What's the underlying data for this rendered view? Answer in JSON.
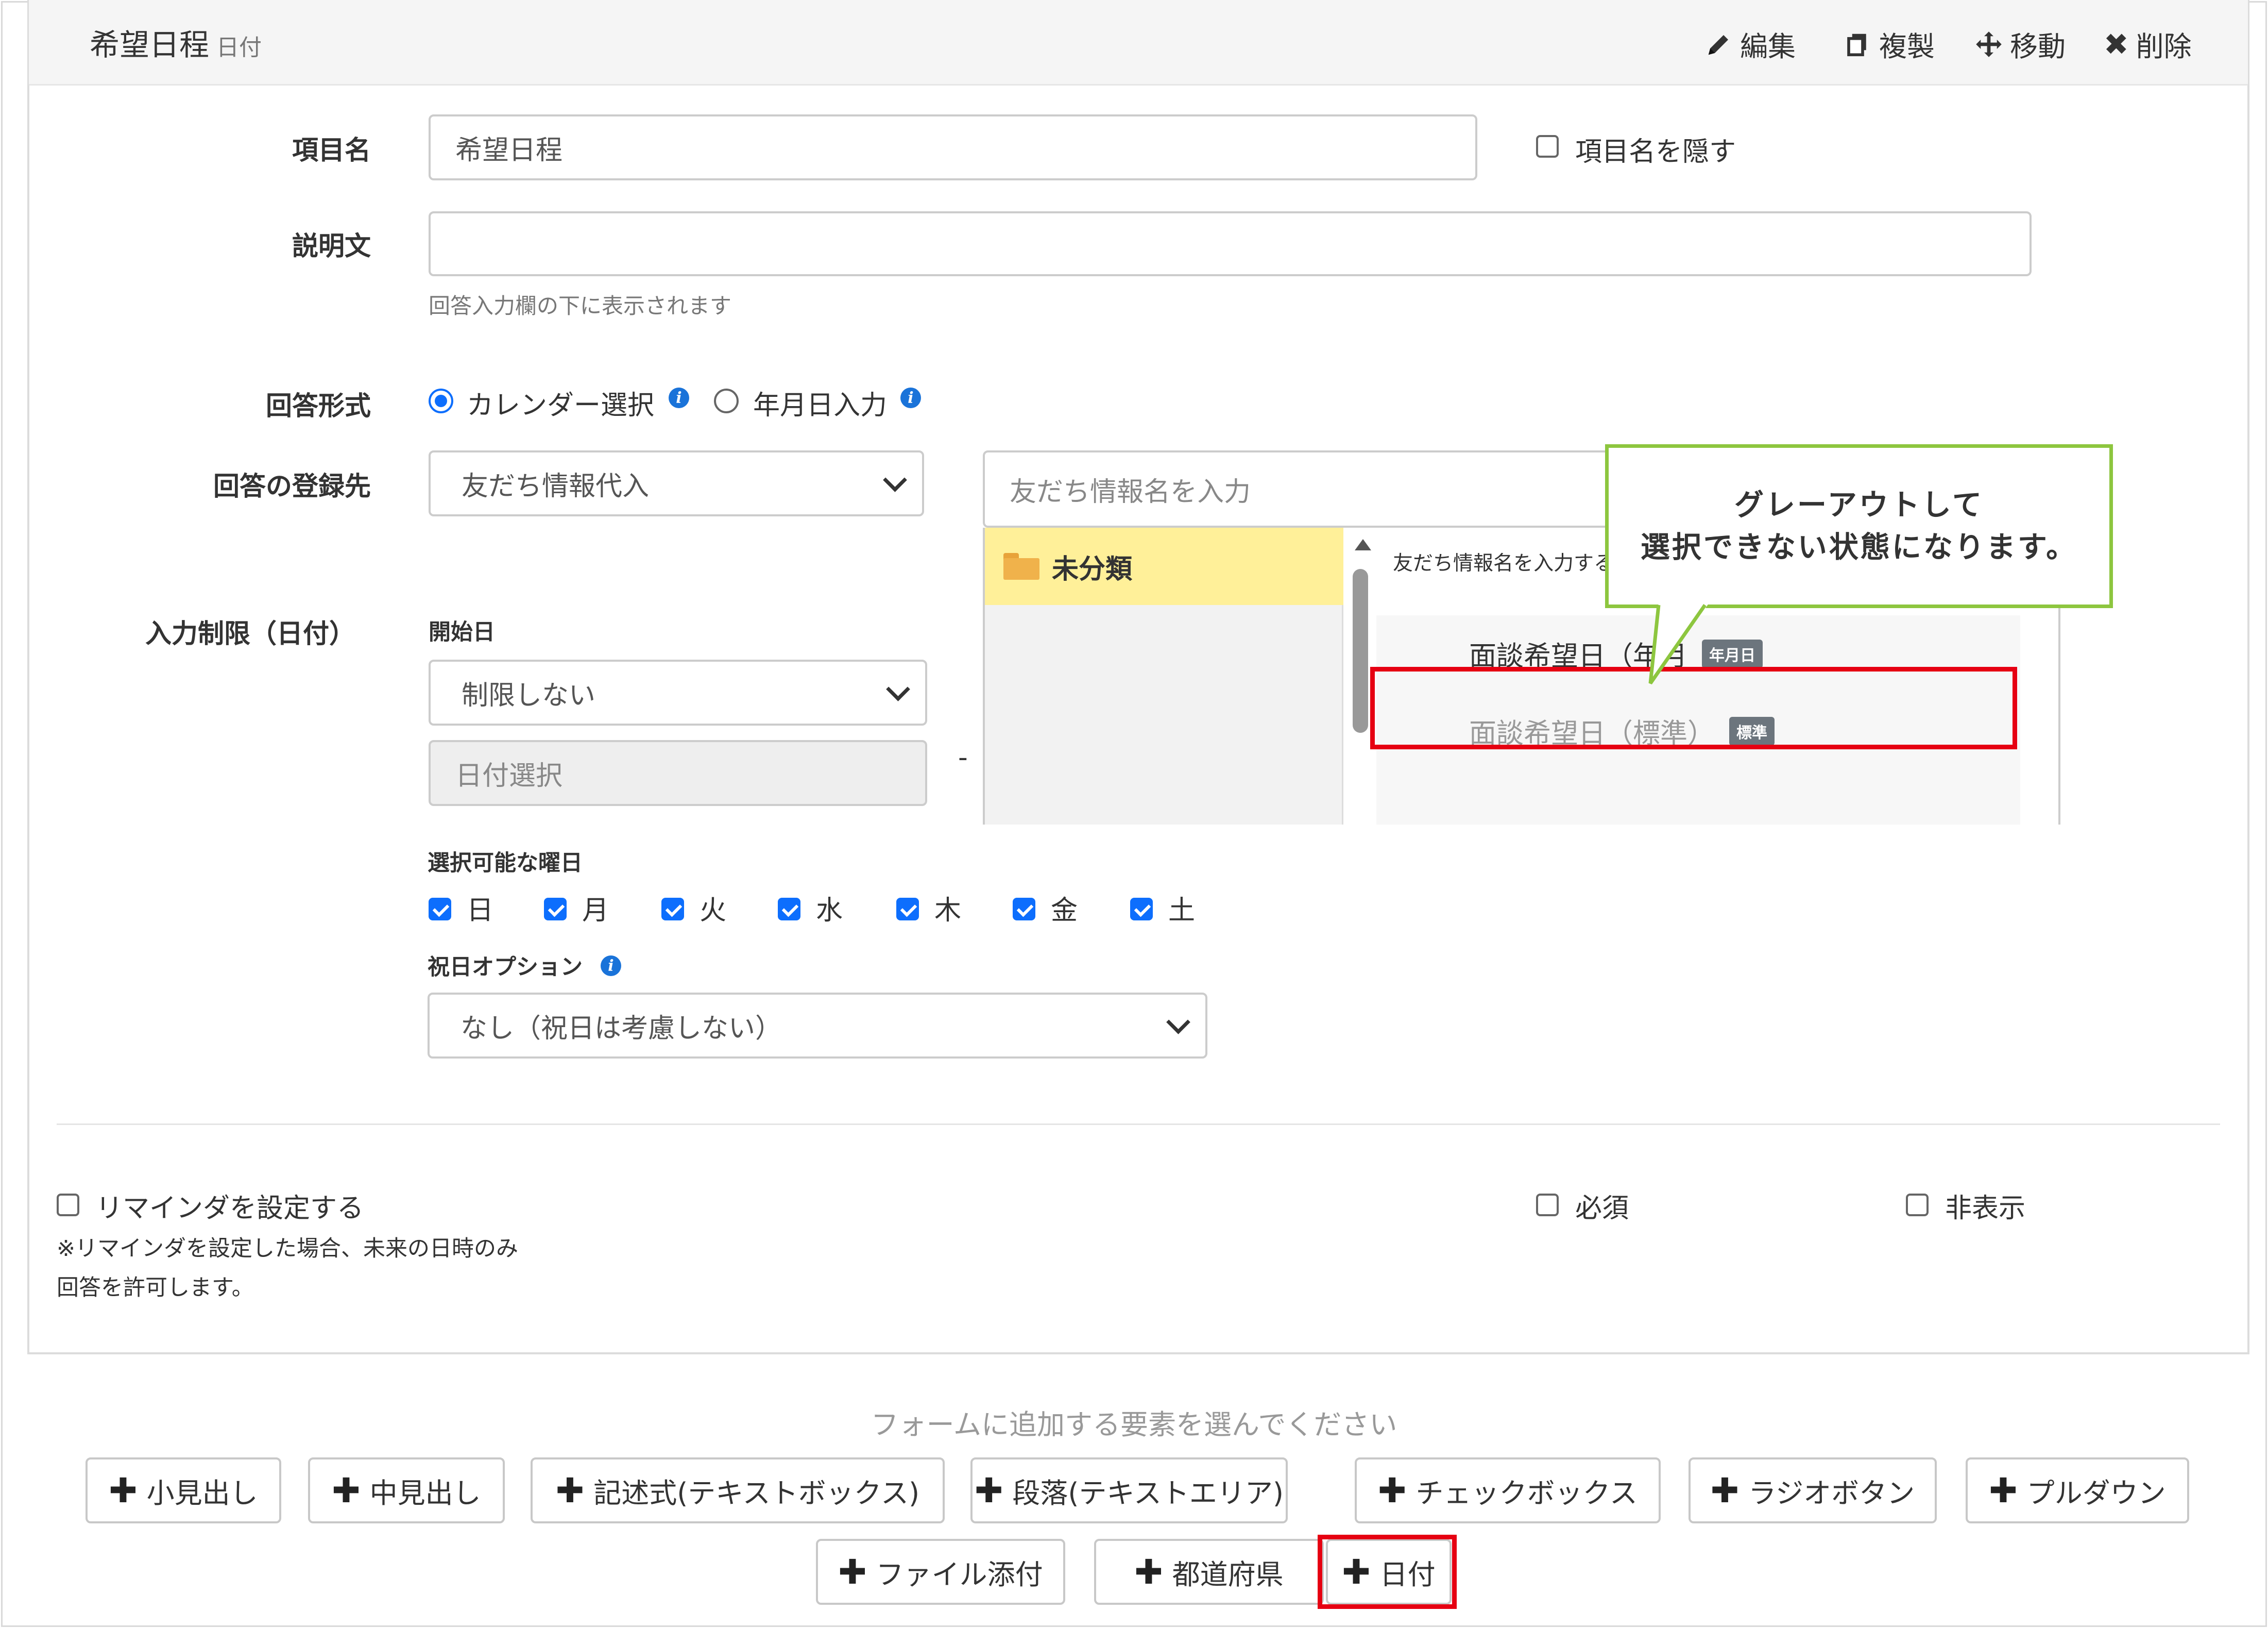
{
  "header": {
    "title": "希望日程",
    "subtitle": "日付",
    "actions": {
      "edit": {
        "icon": "pencil-icon",
        "label": "編集"
      },
      "copy": {
        "icon": "copy-icon",
        "label": "複製"
      },
      "move": {
        "icon": "move-icon",
        "label": "移動"
      },
      "delete": {
        "icon": "close-icon",
        "label": "削除"
      }
    }
  },
  "form": {
    "item_name": {
      "label": "項目名",
      "value": "希望日程",
      "hide_label": "項目名を隠す",
      "hide_checked": false
    },
    "description": {
      "label": "説明文",
      "value": "",
      "hint": "回答入力欄の下に表示されます"
    },
    "answer_format": {
      "label": "回答形式",
      "options": [
        "カレンダー選択",
        "年月日入力"
      ],
      "selected": "カレンダー選択"
    },
    "register_to": {
      "label": "回答の登録先",
      "selected": "友だち情報代入",
      "search_placeholder": "友だち情報名を入力"
    },
    "input_limit": {
      "label": "入力制限（日付）",
      "start_label": "開始日",
      "start_selected": "制限しない",
      "date_placeholder": "日付選択",
      "separator": "-"
    },
    "weekdays": {
      "label": "選択可能な曜日",
      "days": [
        {
          "label": "日",
          "checked": true
        },
        {
          "label": "月",
          "checked": true
        },
        {
          "label": "火",
          "checked": true
        },
        {
          "label": "水",
          "checked": true
        },
        {
          "label": "木",
          "checked": true
        },
        {
          "label": "金",
          "checked": true
        },
        {
          "label": "土",
          "checked": true
        }
      ]
    },
    "holiday": {
      "label": "祝日オプション",
      "selected": "なし（祝日は考慮しない）"
    },
    "reminder": {
      "label": "リマインダを設定する",
      "note_line1": "※リマインダを設定した場合、未来の日時のみ",
      "note_line2": "回答を許可します。",
      "checked": false
    },
    "required": {
      "label": "必須",
      "checked": false
    },
    "hidden": {
      "label": "非表示",
      "checked": false
    }
  },
  "picker": {
    "category": "未分類",
    "list_header": "友だち情報名を入力する",
    "items": [
      {
        "name": "面談希望日（年月",
        "badge": "年月日",
        "disabled": false
      },
      {
        "name": "面談希望日（標準）",
        "badge": "標準",
        "disabled": true
      }
    ]
  },
  "callout": {
    "line1": "グレーアウトして",
    "line2": "選択できない状態になります。",
    "border_color": "#8dc63f"
  },
  "add_elements": {
    "prompt": "フォームに追加する要素を選んでください",
    "buttons": [
      "小見出し",
      "中見出し",
      "記述式(テキストボックス)",
      "段落(テキストエリア)",
      "チェックボックス",
      "ラジオボタン",
      "プルダウン",
      "ファイル添付",
      "都道府県",
      "日付"
    ]
  },
  "colors": {
    "accent": "#0d6efd",
    "highlight": "#e60012",
    "category_bg": "#fff099"
  }
}
